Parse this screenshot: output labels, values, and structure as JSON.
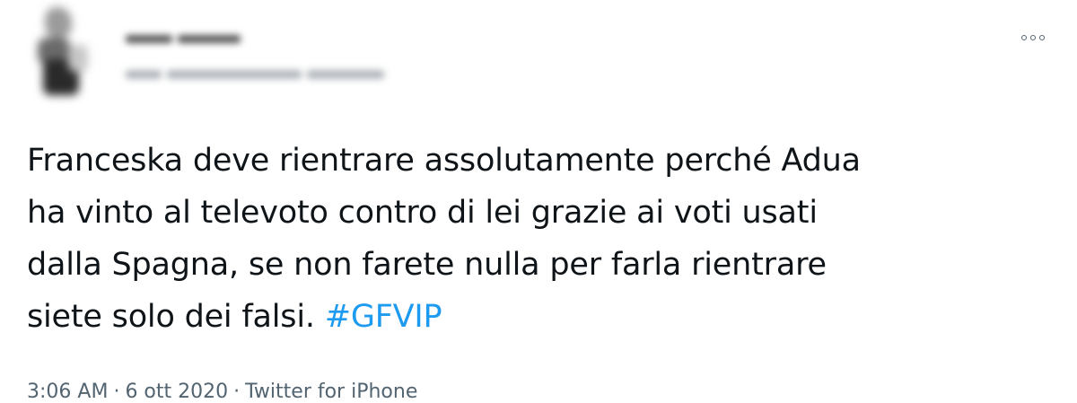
{
  "tweet": {
    "text_lines": [
      "Franceska deve rientrare assolutamente perché Adua",
      "ha vinto al televoto contro di lei grazie ai voti usati",
      "dalla Spagna, se non farete nulla per farla rientrare",
      "siete solo dei falsi. "
    ],
    "hashtag": "#GFVIP",
    "time": "3:06 AM",
    "date": "6 ott 2020",
    "source": "Twitter for iPhone",
    "separator": "·"
  },
  "colors": {
    "text": "#0f1419",
    "muted": "#536471",
    "link": "#1d9bf0"
  },
  "icons": {
    "more": "more-options-icon"
  }
}
